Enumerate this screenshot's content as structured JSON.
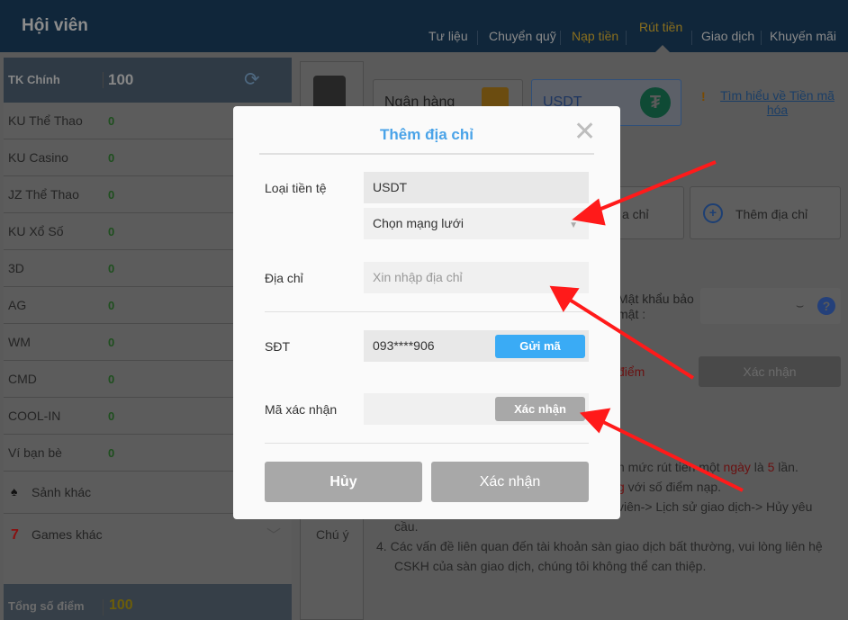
{
  "header": {
    "title": "Hội viên",
    "nav": [
      "Tư liệu",
      "Chuyển quỹ",
      "Nạp tiền",
      "Rút tiền",
      "Giao dịch",
      "Khuyến mãi"
    ],
    "active": "Rút tiền"
  },
  "sidebar": {
    "main_account": {
      "label": "TK Chính",
      "value": "100"
    },
    "accounts": [
      {
        "label": "KU Thể Thao",
        "value": "0"
      },
      {
        "label": "KU Casino",
        "value": "0"
      },
      {
        "label": "JZ Thể Thao",
        "value": "0"
      },
      {
        "label": "KU Xổ Số",
        "value": "0"
      },
      {
        "label": "3D",
        "value": "0"
      },
      {
        "label": "AG",
        "value": "0"
      },
      {
        "label": "WM",
        "value": "0"
      },
      {
        "label": "CMD",
        "value": "0"
      },
      {
        "label": "COOL-IN",
        "value": "0"
      },
      {
        "label": "Ví bạn bè",
        "value": "0"
      }
    ],
    "groups": [
      "Sảnh khác",
      "Games khác"
    ],
    "total": {
      "label": "Tổng số điểm",
      "value": "100"
    }
  },
  "content": {
    "methods": [
      "Ngân hàng",
      "USDT"
    ],
    "learn_link": "Tìm hiểu về Tiền mã hóa",
    "address_card_partial": "a chỉ",
    "add_address": "Thêm địa chỉ",
    "password_label": "Mật khẩu bảo mật :",
    "points_partial": "điểm",
    "confirm": "Xác nhận",
    "side_tab": "Chú ý",
    "notes": [
      {
        "text": "n mức rút tiền một ",
        "red1": "ngày",
        "mid": " là ",
        "red2": "5",
        "end": " lần."
      },
      {
        "red": "g",
        "text": " với số điểm nạp."
      },
      {
        "text": "viên-> Lịch sử giao dịch-> Hủy yêu"
      },
      {
        "text": "cầu."
      },
      {
        "num": "4.",
        "text": "Các vấn đề liên quan đến tài khoản sàn giao dịch bất thường, vui lòng liên hệ"
      },
      {
        "text": "CSKH của sàn giao dịch, chúng tôi không thể can thiệp."
      }
    ]
  },
  "modal": {
    "title": "Thêm địa chỉ",
    "currency_label": "Loại tiền tệ",
    "currency_value": "USDT",
    "network_placeholder": "Chọn mạng lưới",
    "address_label": "Địa chỉ",
    "address_placeholder": "Xin nhập địa chỉ",
    "phone_label": "SĐT",
    "phone_value": "093****906",
    "send_code": "Gửi mã",
    "code_label": "Mã xác nhận",
    "verify": "Xác nhận",
    "cancel": "Hủy",
    "confirm": "Xác nhận"
  },
  "colors": {
    "accent": "#4aa3e8",
    "send_button": "#3aabf5",
    "disabled": "#a8a8a8",
    "annotation_arrow": "#ff1a1a"
  }
}
